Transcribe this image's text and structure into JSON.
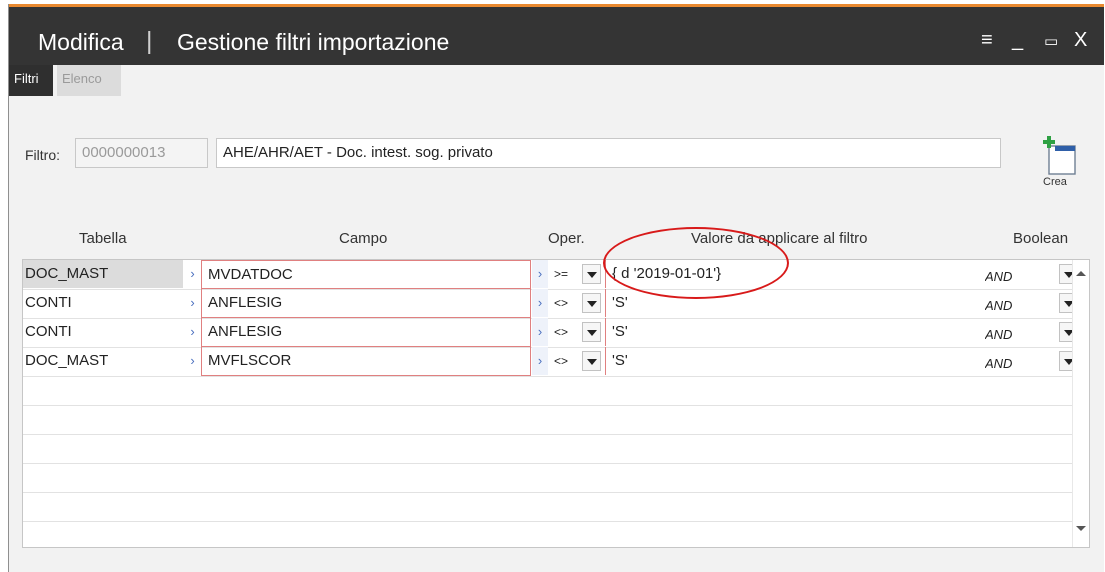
{
  "window": {
    "mode": "Modifica",
    "separator": "|",
    "title": "Gestione filtri importazione",
    "controls": [
      "≡",
      "_",
      "▭",
      "X"
    ]
  },
  "tabs": [
    {
      "label": "Filtri",
      "active": true
    },
    {
      "label": "Elenco",
      "active": false
    }
  ],
  "filter": {
    "label": "Filtro:",
    "code": "0000000013",
    "description": "AHE/AHR/AET - Doc. intest. sog. privato"
  },
  "toolbar": {
    "create_label": "Crea"
  },
  "grid": {
    "headers": {
      "table": "Tabella",
      "field": "Campo",
      "operator": "Oper.",
      "value": "Valore da applicare al filtro",
      "boolean": "Boolean"
    },
    "rows": [
      {
        "table": "DOC_MAST",
        "field": "MVDATDOC",
        "operator": ">=",
        "value": "{ d '2019-01-01'}",
        "boolean": "AND"
      },
      {
        "table": "CONTI",
        "field": "ANFLESIG",
        "operator": "<>",
        "value": "'S'",
        "boolean": "AND"
      },
      {
        "table": "CONTI",
        "field": "ANFLESIG",
        "operator": "<>",
        "value": "'S'",
        "boolean": "AND"
      },
      {
        "table": "DOC_MAST",
        "field": "MVFLSCOR",
        "operator": "<>",
        "value": "'S'",
        "boolean": "AND"
      }
    ]
  },
  "colors": {
    "accent": "#e9892f",
    "titlebar": "#343434",
    "annotation": "#d81a1a"
  },
  "icons": {
    "create": "crea-new-record-icon",
    "menu": "hamburger-menu-icon"
  }
}
